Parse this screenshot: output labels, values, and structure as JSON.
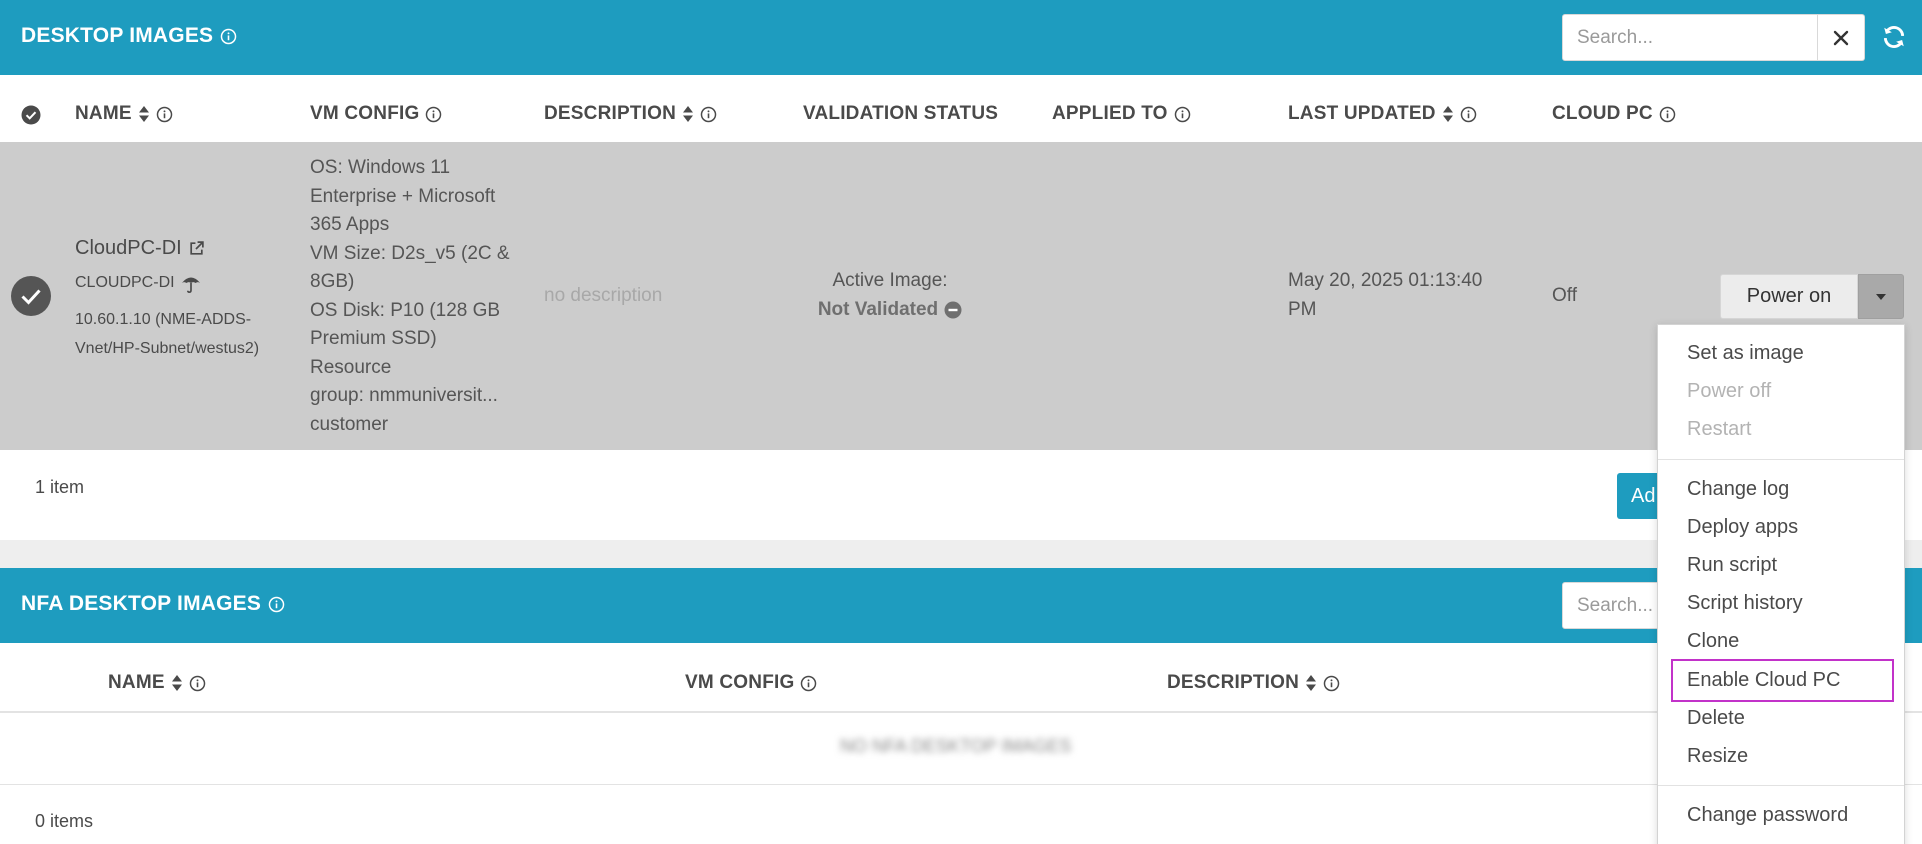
{
  "desktop_images": {
    "title": "DESKTOP IMAGES",
    "search_placeholder": "Search...",
    "columns": {
      "name": "NAME",
      "vm_config": "VM CONFIG",
      "description": "DESCRIPTION",
      "validation_status": "VALIDATION STATUS",
      "applied_to": "APPLIED TO",
      "last_updated": "LAST UPDATED",
      "cloud_pc": "CLOUD PC"
    },
    "row": {
      "name": "CloudPC-DI",
      "sub_name": "CLOUDPC-DI",
      "network_line1": "10.60.1.10 (NME-ADDS-",
      "network_line2": "Vnet/HP-Subnet/westus2)",
      "vm_config_lines": [
        "OS: Windows 11",
        "Enterprise + Microsoft",
        "365 Apps",
        "VM Size: D2s_v5 (2C &",
        "8GB)",
        "OS Disk: P10 (128 GB",
        "Premium SSD)",
        "Resource",
        "group: nmmuniversit...",
        "customer"
      ],
      "description": "no description",
      "validation_line1": "Active Image:",
      "validation_line2": "Not Validated",
      "last_updated_line1": "May 20, 2025 01:13:40",
      "last_updated_line2": "PM",
      "cloud_pc": "Off",
      "action_button": "Power on"
    },
    "item_count": "1 item",
    "add_button_partial": "Ad"
  },
  "dropdown_menu": {
    "items": [
      {
        "label": "Set as image",
        "disabled": false
      },
      {
        "label": "Power off",
        "disabled": true
      },
      {
        "label": "Restart",
        "disabled": true
      },
      {
        "label": "Change log",
        "disabled": false
      },
      {
        "label": "Deploy apps",
        "disabled": false
      },
      {
        "label": "Run script",
        "disabled": false
      },
      {
        "label": "Script history",
        "disabled": false
      },
      {
        "label": "Clone",
        "disabled": false
      },
      {
        "label": "Enable Cloud PC",
        "disabled": false,
        "highlighted": true
      },
      {
        "label": "Delete",
        "disabled": false
      },
      {
        "label": "Resize",
        "disabled": false
      },
      {
        "label": "Change password",
        "disabled": false
      }
    ]
  },
  "nfa_desktop_images": {
    "title": "NFA DESKTOP IMAGES",
    "search_placeholder": "Search...",
    "columns": {
      "name": "NAME",
      "vm_config": "VM CONFIG",
      "description": "DESCRIPTION"
    },
    "empty_message": "NO NFA DESKTOP IMAGES",
    "item_count": "0 items"
  },
  "colors": {
    "header_bg": "#1e9cbf",
    "selected_row_bg": "#cccccc",
    "highlight_border": "#c232c9"
  }
}
